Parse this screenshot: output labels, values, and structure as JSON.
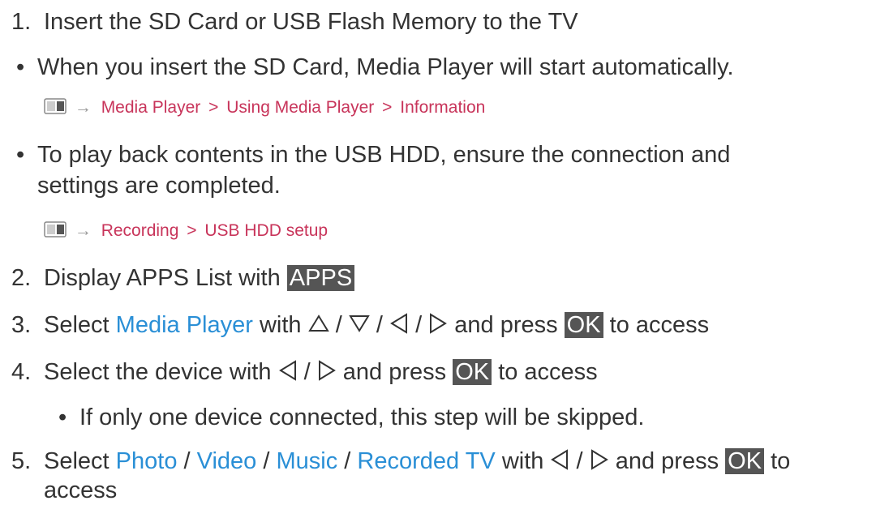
{
  "steps": {
    "s1": {
      "num": "1.",
      "text": "Insert the SD Card or USB Flash Memory to the TV"
    },
    "b1": {
      "text": "When you insert the SD Card, Media Player will start automatically."
    },
    "ref1": {
      "items": [
        "Media Player",
        "Using Media Player",
        "Information"
      ],
      "sep": ">"
    },
    "b2": {
      "line1": "To play back contents in the USB HDD, ensure the connection and",
      "line2": "settings are completed."
    },
    "ref2": {
      "items": [
        "Recording",
        "USB HDD setup"
      ],
      "sep": ">"
    },
    "s2": {
      "num": "2.",
      "text": "Display APPS List with",
      "button": "APPS"
    },
    "s3": {
      "num": "3.",
      "pre": "Select",
      "link": "Media Player",
      "mid": "with",
      "slash": "/",
      "post": "and press",
      "button": "OK",
      "tail": "to access"
    },
    "s4": {
      "num": "4.",
      "pre": "Select the device with",
      "slash": "/",
      "post": "and press",
      "button": "OK",
      "tail": "to access"
    },
    "b3": {
      "text": "If only one device connected, this step will be skipped."
    },
    "s5": {
      "num": "5.",
      "pre": "Select",
      "links": [
        "Photo",
        "Video",
        "Music",
        "Recorded TV"
      ],
      "slash": "/",
      "mid": "with",
      "post": "and press",
      "button": "OK",
      "tail": "to",
      "line2": "access"
    }
  },
  "bullet_char": "•",
  "icons": [
    "tv-menu-icon",
    "arrow-right-icon",
    "triangle-up-icon",
    "triangle-down-icon",
    "triangle-left-icon",
    "triangle-right-icon"
  ],
  "colors": {
    "link_blue": "#2a8fd6",
    "ref_red": "#c8345a",
    "button_bg": "#555555",
    "text": "#333333"
  }
}
